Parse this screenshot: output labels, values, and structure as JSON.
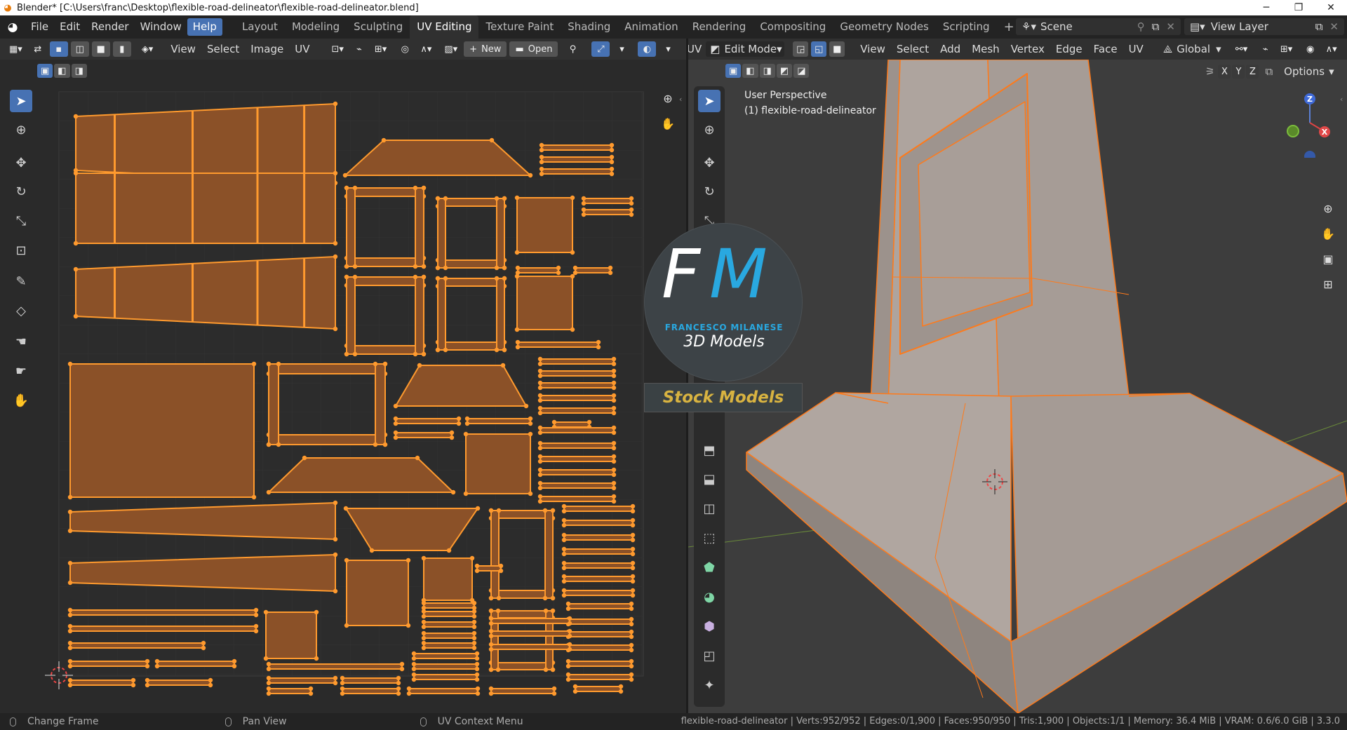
{
  "window": {
    "title": "Blender* [C:\\Users\\franc\\Desktop\\flexible-road-delineator\\flexible-road-delineator.blend]",
    "minimize": "─",
    "maximize": "❐",
    "close": "✕"
  },
  "menu": [
    "File",
    "Edit",
    "Render",
    "Window",
    "Help"
  ],
  "workspaces": [
    "Layout",
    "Modeling",
    "Sculpting",
    "UV Editing",
    "Texture Paint",
    "Shading",
    "Animation",
    "Rendering",
    "Compositing",
    "Geometry Nodes",
    "Scripting"
  ],
  "active_workspace": "UV Editing",
  "scene": "Scene",
  "view_layer": "View Layer",
  "uv_editor": {
    "menus": [
      "View",
      "Select",
      "Image",
      "UV"
    ],
    "new_label": "New",
    "open_label": "Open"
  },
  "viewport": {
    "mode": "Edit Mode",
    "uv_cut": "UV",
    "menus": [
      "View",
      "Select",
      "Add",
      "Mesh",
      "Vertex",
      "Edge",
      "Face",
      "UV"
    ],
    "orientation": "Global",
    "perspective": "User Perspective",
    "object": "(1) flexible-road-delineator",
    "axes": [
      "X",
      "Y",
      "Z"
    ],
    "options": "Options"
  },
  "watermark": {
    "monogram_f": "F",
    "monogram_m": "M",
    "author": "FRANCESCO MILANESE",
    "line": "3D Models",
    "banner": "Stock Models"
  },
  "status": {
    "left": [
      "Change Frame",
      "Pan View",
      "UV Context Menu"
    ],
    "right": "flexible-road-delineator | Verts:952/952 | Edges:0/1,900 | Faces:950/950 | Tris:1,900 | Objects:1/1 | Memory: 36.4 MiB | VRAM: 0.6/6.0 GiB | 3.3.0"
  },
  "colors": {
    "accent": "#4772b3",
    "uv_fill": "#8b5128",
    "uv_edge": "#ff9a2e",
    "mesh_fill": "#a89e98",
    "mesh_edge": "#ff7a1a",
    "watermark_blue": "#29a8e0",
    "banner_text": "#d8b341"
  }
}
